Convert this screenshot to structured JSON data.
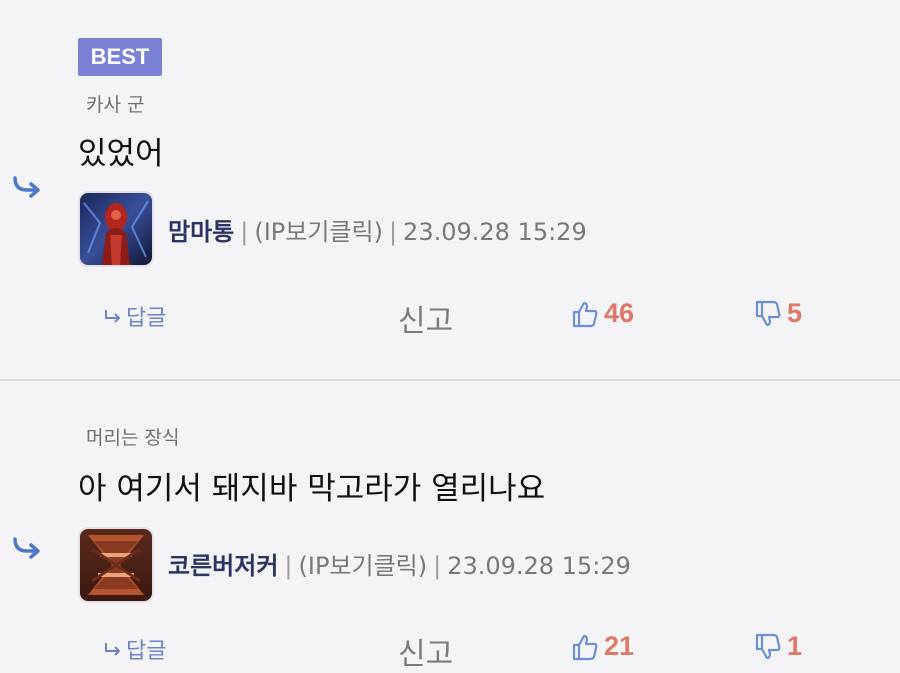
{
  "comments": [
    {
      "badge": "BEST",
      "parent_author": "카사 군",
      "text": "있었어",
      "nickname": "맘마통",
      "separator": "|",
      "ip_label": "(IP보기클릭)",
      "timestamp": "23.09.28 15:29",
      "actions": {
        "reply_label": "답글",
        "report_label": "신고",
        "likes": "46",
        "dislikes": "5"
      }
    },
    {
      "parent_author": "머리는 장식",
      "text": "아 여기서 돼지바 막고라가 열리나요",
      "nickname": "코른버저커",
      "separator": "|",
      "ip_label": "(IP보기클릭)",
      "timestamp": "23.09.28 15:29",
      "actions": {
        "reply_label": "답글",
        "report_label": "신고",
        "likes": "21",
        "dislikes": "1"
      }
    }
  ],
  "colors": {
    "accent": "#6c84c9",
    "badge": "#7b82d6",
    "vote_count": "#de7868",
    "nickname": "#2a3563"
  },
  "icons": {
    "reply_indicator": "reply-arrow-icon",
    "reply": "reply-arrow-small-icon",
    "like": "thumbs-up-icon",
    "dislike": "thumbs-down-icon"
  }
}
